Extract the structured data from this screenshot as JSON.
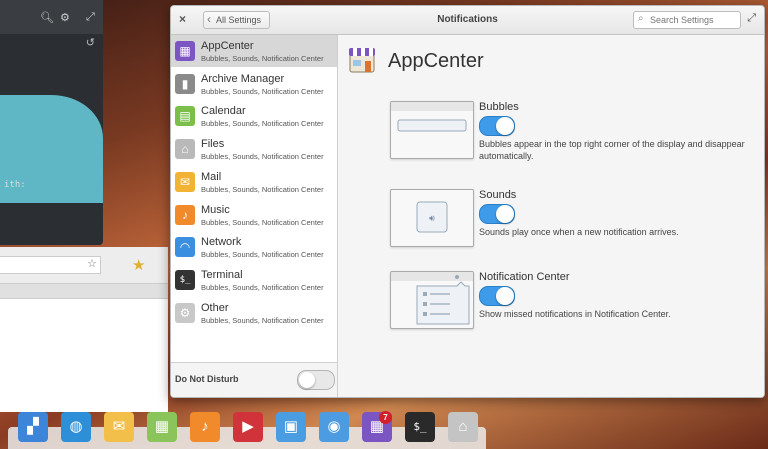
{
  "window": {
    "title": "Notifications",
    "back_label": "All Settings",
    "search_placeholder": "Search Settings",
    "close_glyph": "×",
    "maximize_glyph": "⤢"
  },
  "sidebar": {
    "items": [
      {
        "name": "AppCenter",
        "sub": "Bubbles, Sounds, Notification Center",
        "icon": "appcenter-icon",
        "glyph": "▦",
        "color": "#7b56c2",
        "selected": true
      },
      {
        "name": "Archive Manager",
        "sub": "Bubbles, Sounds, Notification Center",
        "icon": "archive-icon",
        "glyph": "▮",
        "color": "#8a8a8a"
      },
      {
        "name": "Calendar",
        "sub": "Bubbles, Sounds, Notification Center",
        "icon": "calendar-icon",
        "glyph": "▤",
        "color": "#7bbf4a"
      },
      {
        "name": "Files",
        "sub": "Bubbles, Sounds, Notification Center",
        "icon": "files-icon",
        "glyph": "⌂",
        "color": "#b9b9b9"
      },
      {
        "name": "Mail",
        "sub": "Bubbles, Sounds, Notification Center",
        "icon": "mail-icon",
        "glyph": "✉",
        "color": "#f2b233"
      },
      {
        "name": "Music",
        "sub": "Bubbles, Sounds, Notification Center",
        "icon": "music-icon",
        "glyph": "♪",
        "color": "#f08a2a"
      },
      {
        "name": "Network",
        "sub": "Bubbles, Sounds, Notification Center",
        "icon": "network-icon",
        "glyph": "◠",
        "color": "#3b8fe0"
      },
      {
        "name": "Terminal",
        "sub": "Bubbles, Sounds, Notification Center",
        "icon": "terminal-icon",
        "glyph": "$_",
        "color": "#333333"
      },
      {
        "name": "Other",
        "sub": "Bubbles, Sounds, Notification Center",
        "icon": "other-icon",
        "glyph": "⚙",
        "color": "#c8c8c8"
      }
    ],
    "dnd_label": "Do Not Disturb"
  },
  "content": {
    "app_title": "AppCenter",
    "options": [
      {
        "title": "Bubbles",
        "desc": "Bubbles appear in the top right corner of the display and disappear automatically.",
        "enabled": true
      },
      {
        "title": "Sounds",
        "desc": "Sounds play once when a new notification arrives.",
        "enabled": true
      },
      {
        "title": "Notification Center",
        "desc": "Show missed notifications in Notification Center.",
        "enabled": true
      }
    ]
  },
  "background": {
    "terminal_text": "ith:",
    "history_icon": "↺"
  },
  "dock": {
    "items": [
      {
        "name": "multitasking-view-icon",
        "glyph": "▞",
        "color": "#3c85d8"
      },
      {
        "name": "web-browser-icon",
        "glyph": "◍",
        "color": "#2d8fd8"
      },
      {
        "name": "mail-icon",
        "glyph": "✉",
        "color": "#f2c04a"
      },
      {
        "name": "calendar-icon",
        "glyph": "▦",
        "color": "#8bc45a"
      },
      {
        "name": "music-icon",
        "glyph": "♪",
        "color": "#f08a2a"
      },
      {
        "name": "videos-icon",
        "glyph": "▶",
        "color": "#d0343a"
      },
      {
        "name": "photos-icon",
        "glyph": "▣",
        "color": "#4a9de0"
      },
      {
        "name": "settings-icon",
        "glyph": "◉",
        "color": "#4d9be0"
      },
      {
        "name": "appcenter-icon",
        "glyph": "▦",
        "color": "#7b56c2"
      },
      {
        "name": "terminal-icon",
        "glyph": "$_",
        "color": "#2a2a2a"
      },
      {
        "name": "files-icon",
        "glyph": "⌂",
        "color": "#c4c4c4"
      }
    ],
    "appcenter_badge": "7"
  }
}
